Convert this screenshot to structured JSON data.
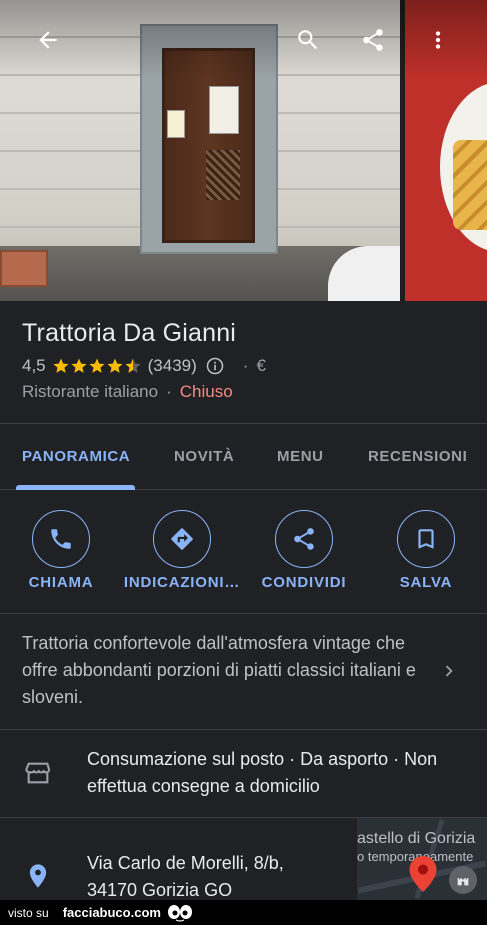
{
  "place": {
    "name": "Trattoria Da Gianni",
    "rating": "4,5",
    "rating_stars": 4.5,
    "reviews": "(3439)",
    "price": "€",
    "category": "Ristorante italiano",
    "status": "Chiuso"
  },
  "tabs": [
    {
      "label": "PANORAMICA",
      "active": true
    },
    {
      "label": "NOVITÀ",
      "active": false
    },
    {
      "label": "MENU",
      "active": false
    },
    {
      "label": "RECENSIONI",
      "active": false
    }
  ],
  "actions": [
    {
      "label": "CHIAMA",
      "icon": "phone-icon"
    },
    {
      "label": "INDICAZIONI…",
      "icon": "directions-icon"
    },
    {
      "label": "CONDIVIDI",
      "icon": "share-icon"
    },
    {
      "label": "SALVA",
      "icon": "bookmark-icon"
    }
  ],
  "description": "Trattoria confortevole dall'atmosfera vintage che offre abbondanti porzioni di piatti classici italiani e sloveni.",
  "service_options": "Consumazione sul posto · Da asporto · Non effettua consegne a domicilio",
  "address": {
    "line1": "Via Carlo de Morelli, 8/b,",
    "line2": "34170 Gorizia GO"
  },
  "map": {
    "label1": "astello di Gorizia",
    "label2": "o temporaneamente"
  },
  "watermark": {
    "prefix": "visto su",
    "site": "facciabuco.com"
  },
  "colors": {
    "background": "#202124",
    "accent": "#8ab4f8",
    "closed": "#f28b82",
    "star": "#fbbc04"
  }
}
